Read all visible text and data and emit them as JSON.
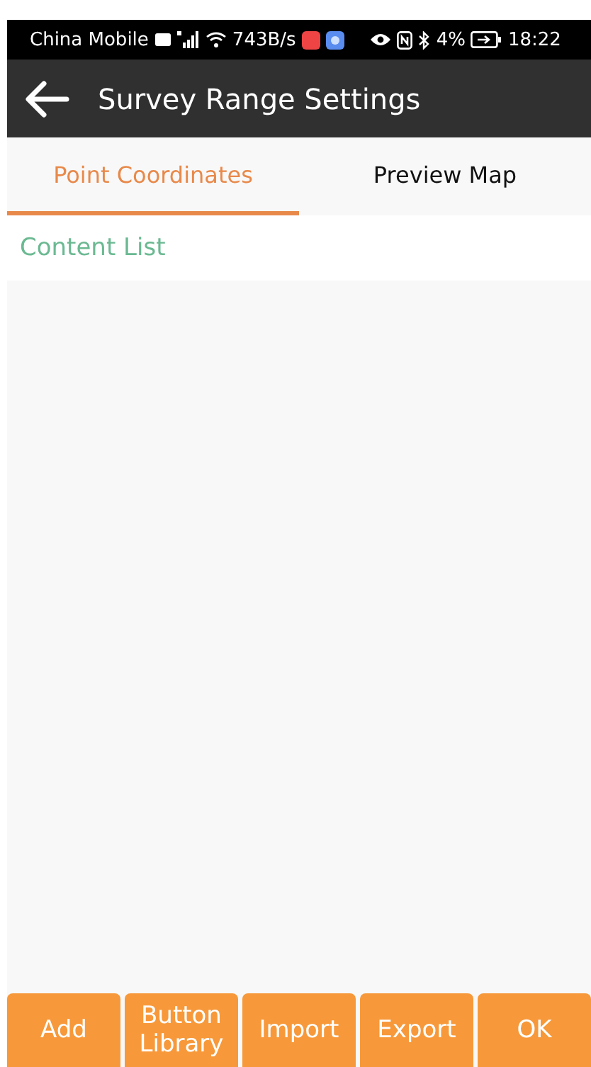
{
  "status_bar": {
    "carrier": "China Mobile",
    "speed": "743B/s",
    "battery": "4%",
    "time": "18:22"
  },
  "app_bar": {
    "title": "Survey Range Settings"
  },
  "tabs": [
    {
      "label": "Point Coordinates",
      "selected": true
    },
    {
      "label": "Preview Map",
      "selected": false
    }
  ],
  "section": {
    "title": "Content List"
  },
  "buttons": [
    {
      "label": "Add"
    },
    {
      "label": "Button Library"
    },
    {
      "label": "Import"
    },
    {
      "label": "Export"
    },
    {
      "label": "OK"
    }
  ]
}
